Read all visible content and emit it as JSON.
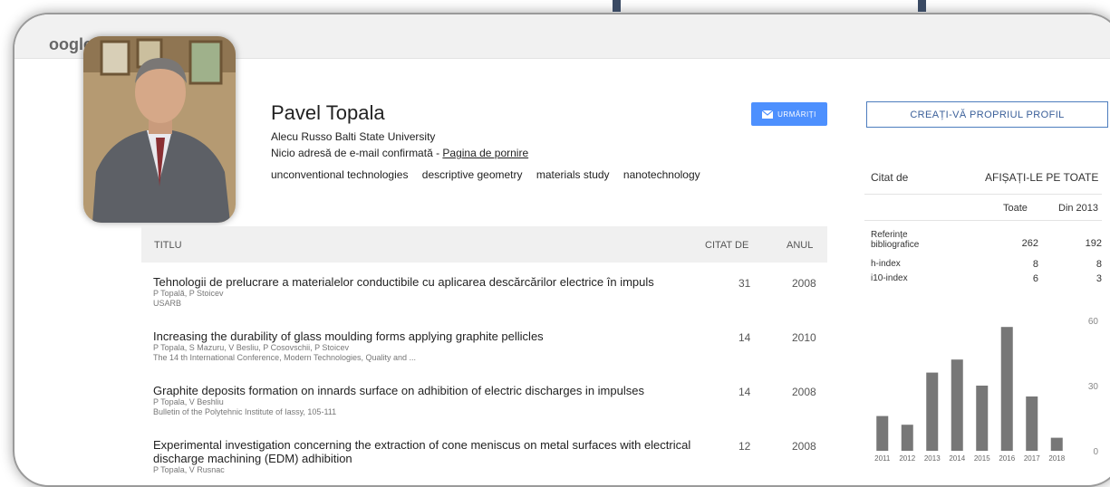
{
  "logo": "oogle",
  "profile": {
    "name": "Pavel Topala",
    "affiliation": "Alecu Russo Balti State University",
    "email_text": "Nicio adresă de e-mail confirmată - ",
    "homepage_label": "Pagina de pornire",
    "keywords": [
      "unconventional technologies",
      "descriptive geometry",
      "materials study",
      "nanotechnology"
    ]
  },
  "buttons": {
    "follow": "URMĂRIȚI",
    "create_profile": "CREAȚI-VĂ PROPRIUL PROFIL"
  },
  "table": {
    "headers": {
      "title": "TITLU",
      "cited_by": "CITAT DE",
      "year": "ANUL"
    },
    "rows": [
      {
        "title": "Tehnologii de prelucrare a materialelor conductibile cu aplicarea descărcărilor electrice în impuls",
        "authors": "P Topală, P Stoicev",
        "venue": "USARB",
        "cited_by": "31",
        "year": "2008"
      },
      {
        "title": "Increasing the durability of glass moulding forms applying graphite pellicles",
        "authors": "P Topala, S Mazuru, V Besliu, P Cosovschii, P Stoicev",
        "venue": "The 14 th International Conference, Modern Technologies, Quality and ...",
        "cited_by": "14",
        "year": "2010"
      },
      {
        "title": "Graphite deposits formation on innards surface on adhibition of electric discharges in impulses",
        "authors": "P Topala, V Beshliu",
        "venue": "Bulletin of the Polytehnic Institute of Iassy, 105-111",
        "cited_by": "14",
        "year": "2008"
      },
      {
        "title": "Experimental investigation concerning the extraction of cone meniscus on metal surfaces with electrical discharge machining (EDM) adhibition",
        "authors": "P Topala, V Rusnac",
        "venue": "",
        "cited_by": "12",
        "year": "2008"
      }
    ]
  },
  "citations": {
    "label": "Citat de",
    "show_all": "AFIȘAȚI-LE PE TOATE",
    "col_all": "Toate",
    "col_since": "Din 2013",
    "stats": [
      {
        "label": "Referințe bibliografice",
        "all": "262",
        "since": "192"
      },
      {
        "label": "h-index",
        "all": "8",
        "since": "8"
      },
      {
        "label": "i10-index",
        "all": "6",
        "since": "3"
      }
    ]
  },
  "chart_data": {
    "type": "bar",
    "categories": [
      "2011",
      "2012",
      "2013",
      "2014",
      "2015",
      "2016",
      "2017",
      "2018"
    ],
    "values": [
      16,
      12,
      36,
      42,
      30,
      57,
      25,
      6
    ],
    "ylim": [
      0,
      60
    ],
    "yticks": [
      "60",
      "30",
      "0"
    ],
    "bar_color": "#777777"
  }
}
